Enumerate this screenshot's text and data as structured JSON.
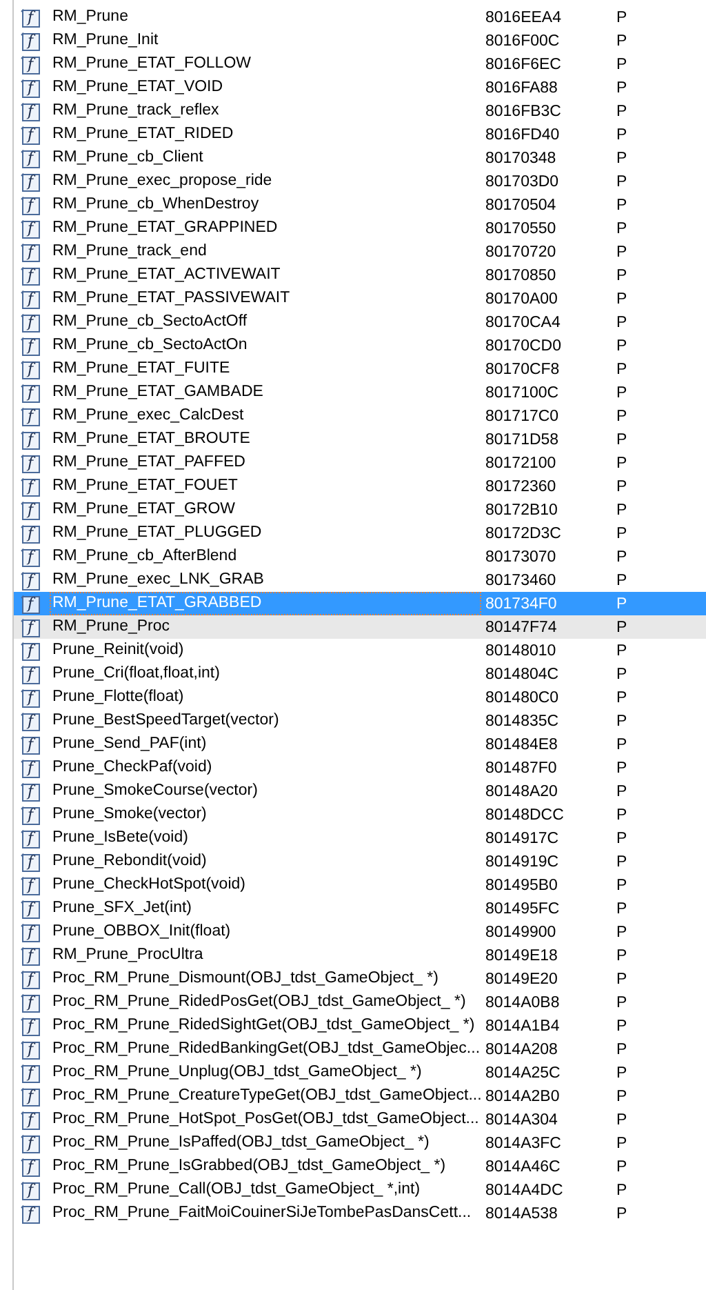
{
  "functions": [
    {
      "icon": "f",
      "name": "RM_Prune",
      "address": "8016EEA4",
      "segment": "P",
      "selected": false,
      "hovered": false
    },
    {
      "icon": "f",
      "name": "RM_Prune_Init",
      "address": "8016F00C",
      "segment": "P",
      "selected": false,
      "hovered": false
    },
    {
      "icon": "f",
      "name": "RM_Prune_ETAT_FOLLOW",
      "address": "8016F6EC",
      "segment": "P",
      "selected": false,
      "hovered": false
    },
    {
      "icon": "f",
      "name": "RM_Prune_ETAT_VOID",
      "address": "8016FA88",
      "segment": "P",
      "selected": false,
      "hovered": false
    },
    {
      "icon": "f",
      "name": "RM_Prune_track_reflex",
      "address": "8016FB3C",
      "segment": "P",
      "selected": false,
      "hovered": false
    },
    {
      "icon": "f",
      "name": "RM_Prune_ETAT_RIDED",
      "address": "8016FD40",
      "segment": "P",
      "selected": false,
      "hovered": false
    },
    {
      "icon": "f",
      "name": "RM_Prune_cb_Client",
      "address": "80170348",
      "segment": "P",
      "selected": false,
      "hovered": false
    },
    {
      "icon": "f",
      "name": "RM_Prune_exec_propose_ride",
      "address": "801703D0",
      "segment": "P",
      "selected": false,
      "hovered": false
    },
    {
      "icon": "f",
      "name": "RM_Prune_cb_WhenDestroy",
      "address": "80170504",
      "segment": "P",
      "selected": false,
      "hovered": false
    },
    {
      "icon": "f",
      "name": "RM_Prune_ETAT_GRAPPINED",
      "address": "80170550",
      "segment": "P",
      "selected": false,
      "hovered": false
    },
    {
      "icon": "f",
      "name": "RM_Prune_track_end",
      "address": "80170720",
      "segment": "P",
      "selected": false,
      "hovered": false
    },
    {
      "icon": "f",
      "name": "RM_Prune_ETAT_ACTIVEWAIT",
      "address": "80170850",
      "segment": "P",
      "selected": false,
      "hovered": false
    },
    {
      "icon": "f",
      "name": "RM_Prune_ETAT_PASSIVEWAIT",
      "address": "80170A00",
      "segment": "P",
      "selected": false,
      "hovered": false
    },
    {
      "icon": "f",
      "name": "RM_Prune_cb_SectoActOff",
      "address": "80170CA4",
      "segment": "P",
      "selected": false,
      "hovered": false
    },
    {
      "icon": "f",
      "name": "RM_Prune_cb_SectoActOn",
      "address": "80170CD0",
      "segment": "P",
      "selected": false,
      "hovered": false
    },
    {
      "icon": "f",
      "name": "RM_Prune_ETAT_FUITE",
      "address": "80170CF8",
      "segment": "P",
      "selected": false,
      "hovered": false
    },
    {
      "icon": "f",
      "name": "RM_Prune_ETAT_GAMBADE",
      "address": "8017100C",
      "segment": "P",
      "selected": false,
      "hovered": false
    },
    {
      "icon": "f",
      "name": "RM_Prune_exec_CalcDest",
      "address": "801717C0",
      "segment": "P",
      "selected": false,
      "hovered": false
    },
    {
      "icon": "f",
      "name": "RM_Prune_ETAT_BROUTE",
      "address": "80171D58",
      "segment": "P",
      "selected": false,
      "hovered": false
    },
    {
      "icon": "f",
      "name": "RM_Prune_ETAT_PAFFED",
      "address": "80172100",
      "segment": "P",
      "selected": false,
      "hovered": false
    },
    {
      "icon": "f",
      "name": "RM_Prune_ETAT_FOUET",
      "address": "80172360",
      "segment": "P",
      "selected": false,
      "hovered": false
    },
    {
      "icon": "f",
      "name": "RM_Prune_ETAT_GROW",
      "address": "80172B10",
      "segment": "P",
      "selected": false,
      "hovered": false
    },
    {
      "icon": "f",
      "name": "RM_Prune_ETAT_PLUGGED",
      "address": "80172D3C",
      "segment": "P",
      "selected": false,
      "hovered": false
    },
    {
      "icon": "f",
      "name": "RM_Prune_cb_AfterBlend",
      "address": "80173070",
      "segment": "P",
      "selected": false,
      "hovered": false
    },
    {
      "icon": "f",
      "name": "RM_Prune_exec_LNK_GRAB",
      "address": "80173460",
      "segment": "P",
      "selected": false,
      "hovered": false
    },
    {
      "icon": "f",
      "name": "RM_Prune_ETAT_GRABBED",
      "address": "801734F0",
      "segment": "P",
      "selected": true,
      "hovered": false
    },
    {
      "icon": "f",
      "name": "RM_Prune_Proc",
      "address": "80147F74",
      "segment": "P",
      "selected": false,
      "hovered": true
    },
    {
      "icon": "f",
      "name": "Prune_Reinit(void)",
      "address": "80148010",
      "segment": "P",
      "selected": false,
      "hovered": false
    },
    {
      "icon": "f",
      "name": "Prune_Cri(float,float,int)",
      "address": "8014804C",
      "segment": "P",
      "selected": false,
      "hovered": false
    },
    {
      "icon": "f",
      "name": "Prune_Flotte(float)",
      "address": "801480C0",
      "segment": "P",
      "selected": false,
      "hovered": false
    },
    {
      "icon": "f",
      "name": "Prune_BestSpeedTarget(vector)",
      "address": "8014835C",
      "segment": "P",
      "selected": false,
      "hovered": false
    },
    {
      "icon": "f",
      "name": "Prune_Send_PAF(int)",
      "address": "801484E8",
      "segment": "P",
      "selected": false,
      "hovered": false
    },
    {
      "icon": "f",
      "name": "Prune_CheckPaf(void)",
      "address": "801487F0",
      "segment": "P",
      "selected": false,
      "hovered": false
    },
    {
      "icon": "f",
      "name": "Prune_SmokeCourse(vector)",
      "address": "80148A20",
      "segment": "P",
      "selected": false,
      "hovered": false
    },
    {
      "icon": "f",
      "name": "Prune_Smoke(vector)",
      "address": "80148DCC",
      "segment": "P",
      "selected": false,
      "hovered": false
    },
    {
      "icon": "f",
      "name": "Prune_IsBete(void)",
      "address": "8014917C",
      "segment": "P",
      "selected": false,
      "hovered": false
    },
    {
      "icon": "f",
      "name": "Prune_Rebondit(void)",
      "address": "8014919C",
      "segment": "P",
      "selected": false,
      "hovered": false
    },
    {
      "icon": "f",
      "name": "Prune_CheckHotSpot(void)",
      "address": "801495B0",
      "segment": "P",
      "selected": false,
      "hovered": false
    },
    {
      "icon": "f",
      "name": "Prune_SFX_Jet(int)",
      "address": "801495FC",
      "segment": "P",
      "selected": false,
      "hovered": false
    },
    {
      "icon": "f",
      "name": "Prune_OBBOX_Init(float)",
      "address": "80149900",
      "segment": "P",
      "selected": false,
      "hovered": false
    },
    {
      "icon": "f",
      "name": "RM_Prune_ProcUltra",
      "address": "80149E18",
      "segment": "P",
      "selected": false,
      "hovered": false
    },
    {
      "icon": "f",
      "name": "Proc_RM_Prune_Dismount(OBJ_tdst_GameObject_ *)",
      "address": "80149E20",
      "segment": "P",
      "selected": false,
      "hovered": false
    },
    {
      "icon": "f",
      "name": "Proc_RM_Prune_RidedPosGet(OBJ_tdst_GameObject_ *)",
      "address": "8014A0B8",
      "segment": "P",
      "selected": false,
      "hovered": false
    },
    {
      "icon": "f",
      "name": "Proc_RM_Prune_RidedSightGet(OBJ_tdst_GameObject_ *)",
      "address": "8014A1B4",
      "segment": "P",
      "selected": false,
      "hovered": false
    },
    {
      "icon": "f",
      "name": "Proc_RM_Prune_RidedBankingGet(OBJ_tdst_GameObjec...",
      "address": "8014A208",
      "segment": "P",
      "selected": false,
      "hovered": false
    },
    {
      "icon": "f",
      "name": "Proc_RM_Prune_Unplug(OBJ_tdst_GameObject_ *)",
      "address": "8014A25C",
      "segment": "P",
      "selected": false,
      "hovered": false
    },
    {
      "icon": "f",
      "name": "Proc_RM_Prune_CreatureTypeGet(OBJ_tdst_GameObject...",
      "address": "8014A2B0",
      "segment": "P",
      "selected": false,
      "hovered": false
    },
    {
      "icon": "f",
      "name": "Proc_RM_Prune_HotSpot_PosGet(OBJ_tdst_GameObject...",
      "address": "8014A304",
      "segment": "P",
      "selected": false,
      "hovered": false
    },
    {
      "icon": "f",
      "name": "Proc_RM_Prune_IsPaffed(OBJ_tdst_GameObject_ *)",
      "address": "8014A3FC",
      "segment": "P",
      "selected": false,
      "hovered": false
    },
    {
      "icon": "f",
      "name": "Proc_RM_Prune_IsGrabbed(OBJ_tdst_GameObject_ *)",
      "address": "8014A46C",
      "segment": "P",
      "selected": false,
      "hovered": false
    },
    {
      "icon": "f",
      "name": "Proc_RM_Prune_Call(OBJ_tdst_GameObject_ *,int)",
      "address": "8014A4DC",
      "segment": "P",
      "selected": false,
      "hovered": false
    },
    {
      "icon": "f",
      "name": "Proc_RM_Prune_FaitMoiCouinerSiJeTombePasDansCett...",
      "address": "8014A538",
      "segment": "P",
      "selected": false,
      "hovered": false
    }
  ]
}
